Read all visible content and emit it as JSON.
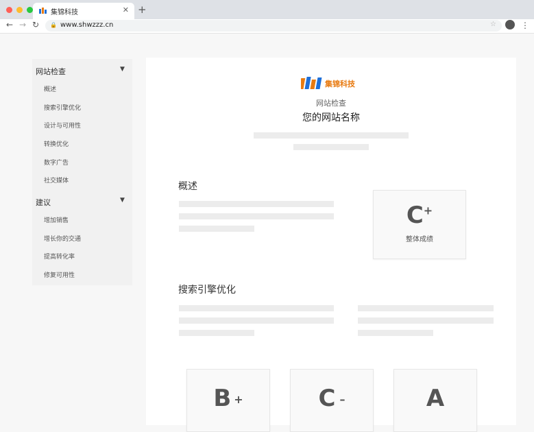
{
  "browser": {
    "tab_title": "集锦科技",
    "url": "www.shwzzz.cn",
    "dot_colors": [
      "#ff5f57",
      "#febc2e",
      "#28c840"
    ]
  },
  "sidebar": {
    "sections": [
      {
        "title": "网站检查",
        "items": [
          "概述",
          "搜索引擎优化",
          "设计与可用性",
          "转换优化",
          "数字广告",
          "社交媒体"
        ]
      },
      {
        "title": "建议",
        "items": [
          "增加销售",
          "增长你的交通",
          "提高转化率",
          "修复可用性"
        ]
      }
    ]
  },
  "main": {
    "logo_text": "集锦科技",
    "subtitle": "网站检查",
    "site_title": "您的网站名称",
    "overview": {
      "heading": "概述",
      "grade": "C",
      "grade_mod": "+",
      "grade_label": "整体成绩"
    },
    "seo": {
      "heading": "搜索引擎优化"
    },
    "cards": [
      {
        "grade": "B",
        "mod": "+"
      },
      {
        "grade": "C",
        "mod": "–"
      },
      {
        "grade": "A",
        "mod": ""
      }
    ]
  },
  "colors": {
    "accent": "#e87a10",
    "logo_blue": "#1e6fd9"
  }
}
